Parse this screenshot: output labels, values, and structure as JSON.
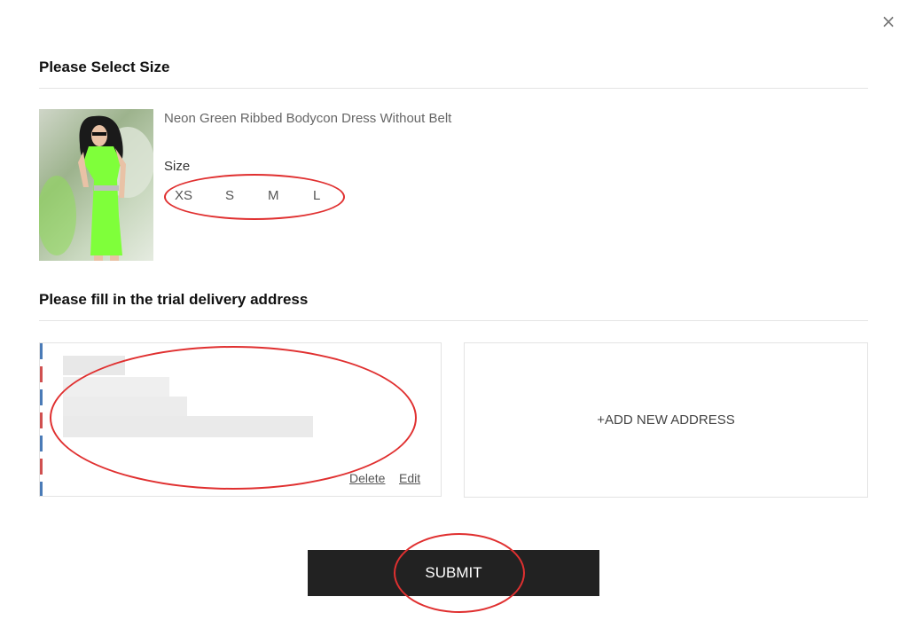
{
  "modal": {
    "close_label": "×"
  },
  "size_section": {
    "title": "Please Select Size",
    "product": {
      "name": "Neon Green Ribbed Bodycon Dress Without Belt"
    },
    "size_label": "Size",
    "sizes": [
      "XS",
      "S",
      "M",
      "L"
    ]
  },
  "address_section": {
    "title": "Please fill in the trial delivery address",
    "saved_address": {
      "delete_label": "Delete",
      "edit_label": "Edit"
    },
    "add_new_label": "+ADD NEW ADDRESS"
  },
  "actions": {
    "submit_label": "SUBMIT"
  },
  "colors": {
    "annotation": "#e03030",
    "submit_bg": "#222222",
    "product_green": "#7fff3a"
  }
}
